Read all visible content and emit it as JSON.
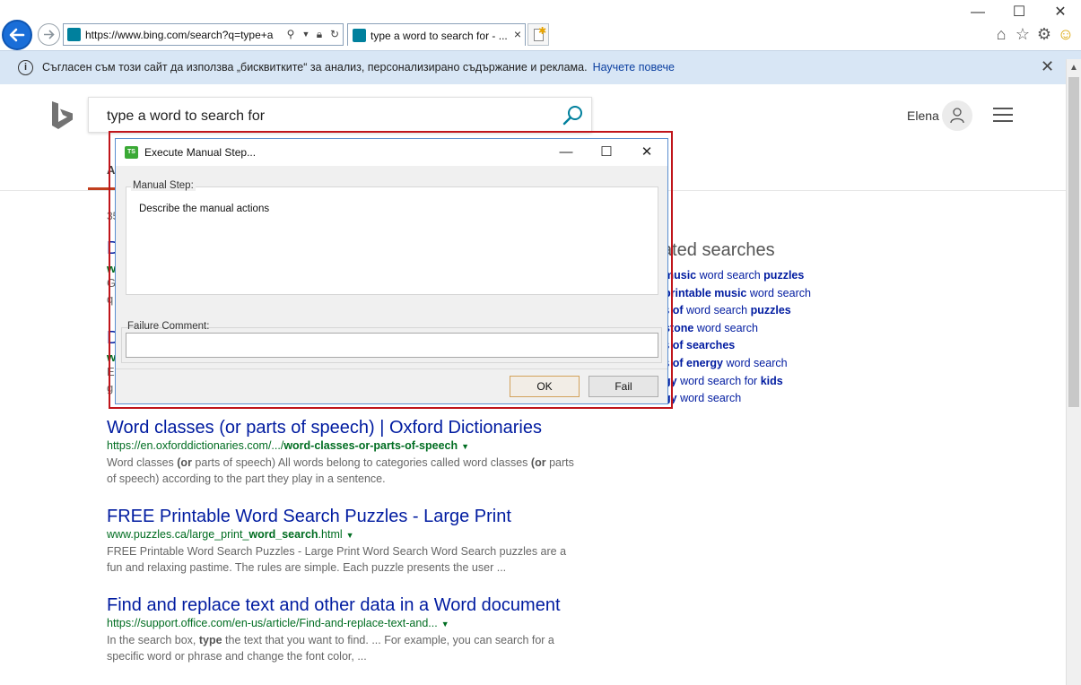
{
  "browser": {
    "address_url": "https://www.bing.com/search?q=type+a",
    "tab_title": "type a word to search for - ...",
    "icons": [
      "back-arrow-icon",
      "forward-arrow-icon",
      "bing-favicon",
      "search-icon",
      "lock-icon",
      "refresh-icon",
      "new-tab-icon",
      "home-icon",
      "favorites-star-icon",
      "gear-icon",
      "smiley-icon"
    ]
  },
  "cookie_bar": {
    "message": "Съгласен съм този сайт да използва „бисквитките“ за анализ, персонализирано съдържание и реклама.",
    "link": "Научете повече"
  },
  "bing": {
    "query": "type a word to search for",
    "user_name": "Elena",
    "nav_visible_letter": "A"
  },
  "hidden_fragments": {
    "count": "35",
    "r1_title": "D",
    "r1_url": "w",
    "r1_s1": "G",
    "r1_s2": "q",
    "r2_title": "D",
    "r2_url": "w",
    "r2_s1": "E",
    "r2_s2": "g"
  },
  "results": [
    {
      "title": "Word classes (or parts of speech) | Oxford Dictionaries",
      "url_pre": "https://en.oxforddictionaries.com/.../",
      "url_bold": "word-classes-or-parts-of-speech",
      "url_post": "",
      "snippet_html_parts": [
        "Word classes ",
        "(or",
        " parts of speech) All words belong to categories called word classes ",
        "(or",
        " parts of speech) according to the part they play in a sentence."
      ]
    },
    {
      "title": "FREE Printable Word Search Puzzles - Large Print",
      "url_pre": "www.puzzles.ca/large_print_",
      "url_bold": "word_search",
      "url_post": ".html",
      "snippet_html_parts": [
        "FREE Printable Word Search Puzzles - Large Print Word Search Word Search puzzles are a fun and relaxing pastime. The rules are simple. Each puzzle presents the user ..."
      ]
    },
    {
      "title": "Find and replace text and other data in a Word document",
      "url_pre": "https://support.office.com/en-us/article/Find-and-replace-text-and...",
      "url_bold": "",
      "url_post": "",
      "snippet_html_parts": [
        "In the search box, ",
        "type",
        " the text that you want to find. ... For example, you can search for a specific word or phrase and change the font color, ..."
      ]
    }
  ],
  "related": {
    "heading": "ated searches",
    "items": [
      {
        "pre": "",
        "b1": "music",
        "mid": " word search ",
        "b2": "puzzles"
      },
      {
        "pre": "",
        "b1": "printable music",
        "mid": " word search",
        "b2": ""
      },
      {
        "pre": "s ",
        "b1": "of",
        "mid": " word search ",
        "b2": "puzzles"
      },
      {
        "pre": "",
        "b1": "stone",
        "mid": " word search",
        "b2": ""
      },
      {
        "pre": "s ",
        "b1": "of searches",
        "mid": "",
        "b2": ""
      },
      {
        "pre": "s ",
        "b1": "of energy",
        "mid": " word search",
        "b2": ""
      },
      {
        "pre": "",
        "b1": "gy",
        "mid": " word search for ",
        "b2": "kids"
      },
      {
        "pre": "",
        "b1": "gy",
        "mid": " word search",
        "b2": ""
      }
    ]
  },
  "dialog": {
    "title": "Execute Manual Step...",
    "logo_text": "TS",
    "manual_step_label": "Manual Step:",
    "manual_step_text": "Describe the manual actions",
    "failure_comment_label": "Failure Comment:",
    "failure_comment_value": "",
    "ok_label": "OK",
    "fail_label": "Fail"
  },
  "colors": {
    "link_blue": "#001ba0",
    "url_green": "#006d21",
    "highlight_red": "#c0151b",
    "cookie_bar_bg": "#d8e6f5"
  }
}
